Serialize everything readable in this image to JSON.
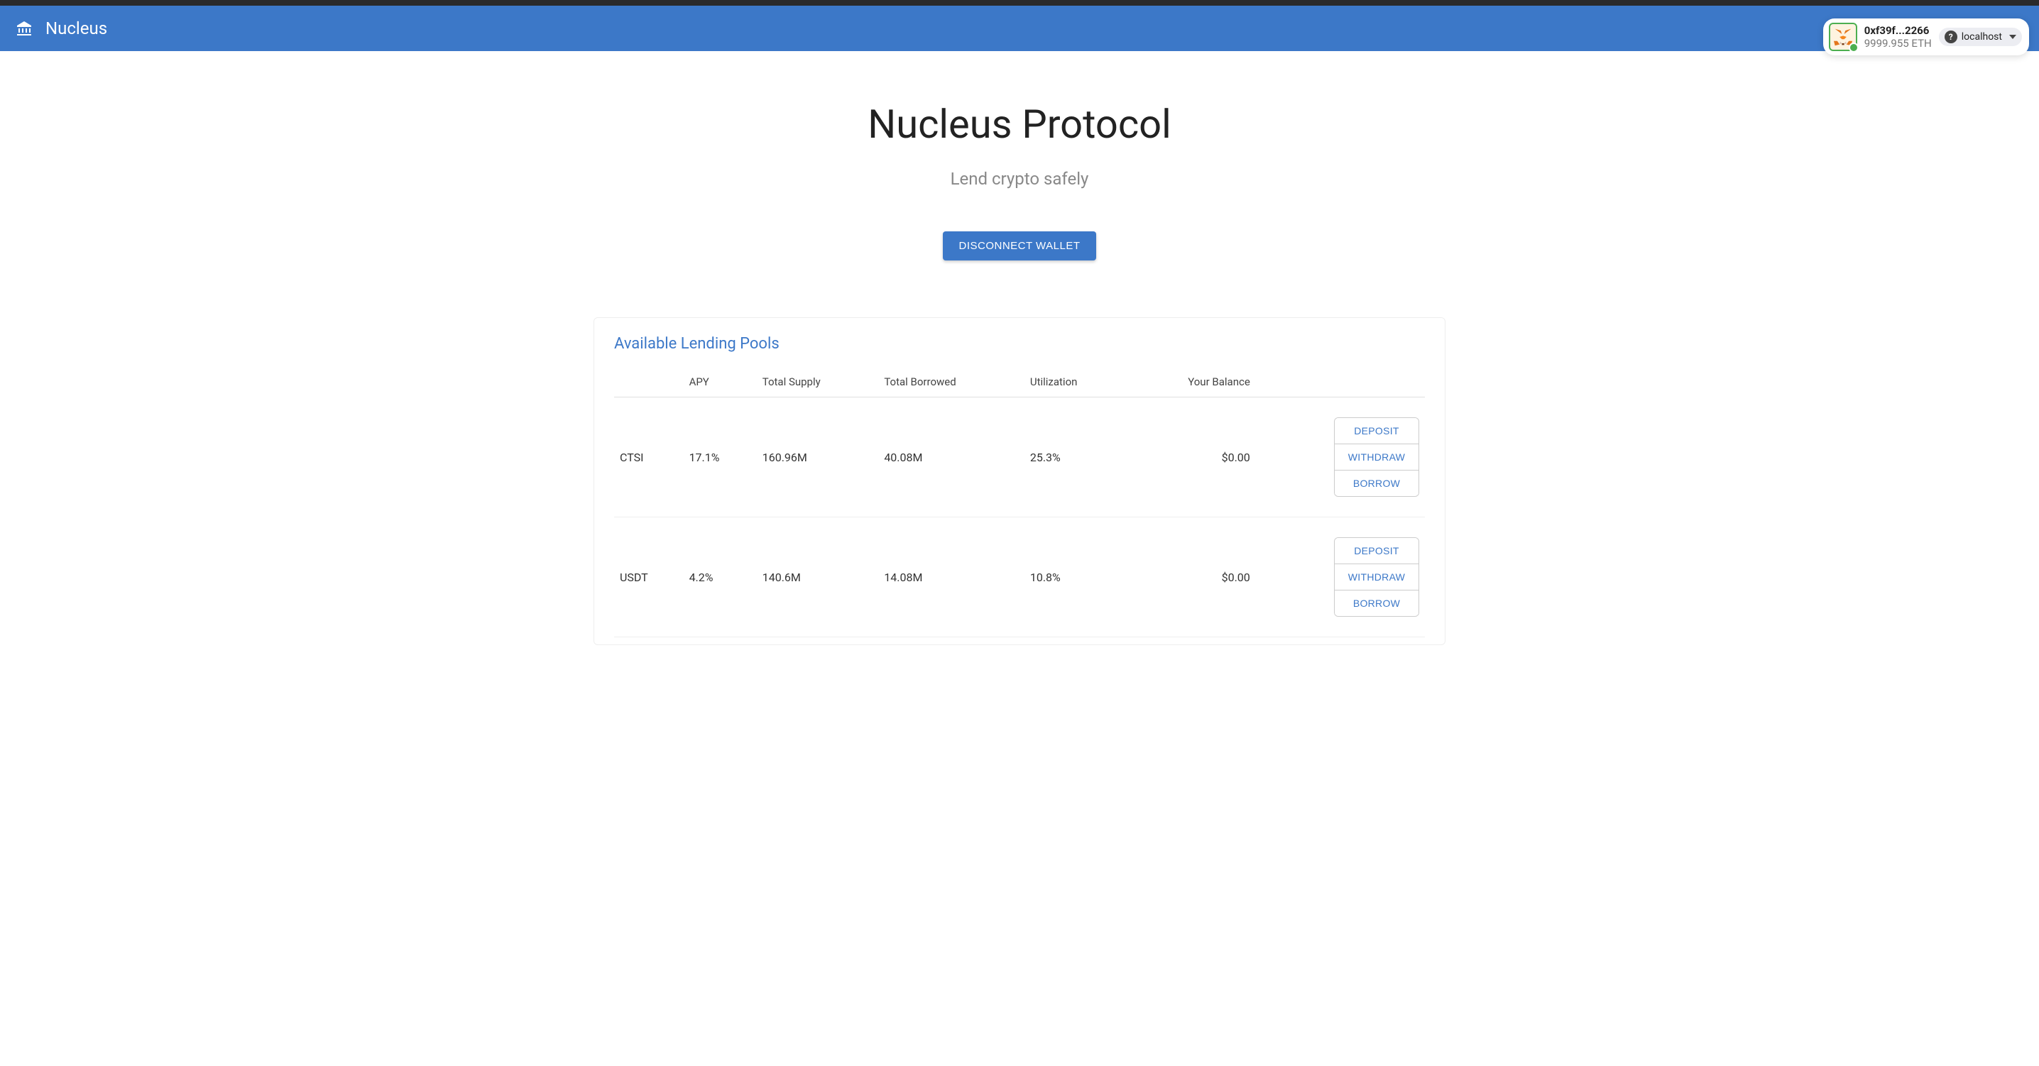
{
  "header": {
    "app_name": "Nucleus"
  },
  "wallet": {
    "address": "0xf39f...2266",
    "balance": "9999.955 ETH",
    "network": "localhost"
  },
  "hero": {
    "title": "Nucleus Protocol",
    "subtitle": "Lend crypto safely",
    "disconnect_label": "DISCONNECT WALLET"
  },
  "pools": {
    "title": "Available Lending Pools",
    "columns": {
      "apy": "APY",
      "supply": "Total Supply",
      "borrowed": "Total Borrowed",
      "utilization": "Utilization",
      "balance": "Your Balance"
    },
    "actions": {
      "deposit": "DEPOSIT",
      "withdraw": "WITHDRAW",
      "borrow": "BORROW"
    },
    "rows": [
      {
        "symbol": "CTSI",
        "apy": "17.1%",
        "supply": "160.96M",
        "borrowed": "40.08M",
        "utilization": "25.3%",
        "balance": "$0.00"
      },
      {
        "symbol": "USDT",
        "apy": "4.2%",
        "supply": "140.6M",
        "borrowed": "14.08M",
        "utilization": "10.8%",
        "balance": "$0.00"
      }
    ]
  }
}
